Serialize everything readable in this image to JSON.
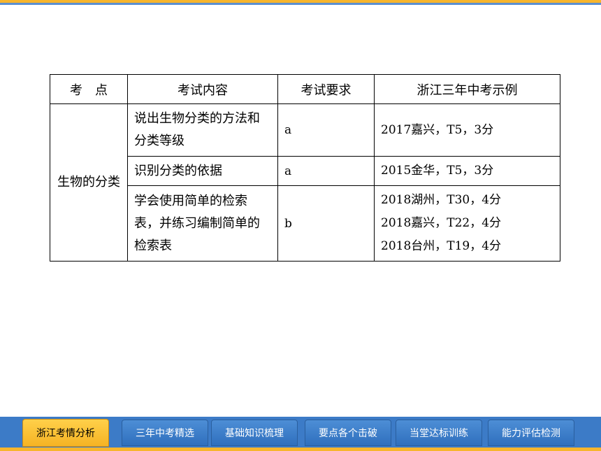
{
  "table": {
    "headers": [
      "考　点",
      "考试内容",
      "考试要求",
      "浙江三年中考示例"
    ],
    "topic": "生物的分类",
    "rows": [
      {
        "content": "说出生物分类的方法和分类等级",
        "requirement": "a",
        "examples": [
          "2017嘉兴，T5，3分"
        ]
      },
      {
        "content": "识别分类的依据",
        "requirement": "a",
        "examples": [
          "2015金华，T5，3分"
        ]
      },
      {
        "content": "学会使用简单的检索表，并练习编制简单的检索表",
        "requirement": "b",
        "examples": [
          "2018湖州，T30，4分",
          "2018嘉兴，T22，4分",
          "2018台州，T19，4分"
        ]
      }
    ]
  },
  "nav": {
    "tabs": [
      "浙江考情分析",
      "三年中考精选",
      "基础知识梳理",
      "要点各个击破",
      "当堂达标训练",
      "能力评估检测"
    ],
    "active": "浙江考情分析"
  },
  "colors": {
    "accent": "#f7b52c",
    "nav": "#3c7bc7",
    "rule": "#5b8fd0"
  }
}
